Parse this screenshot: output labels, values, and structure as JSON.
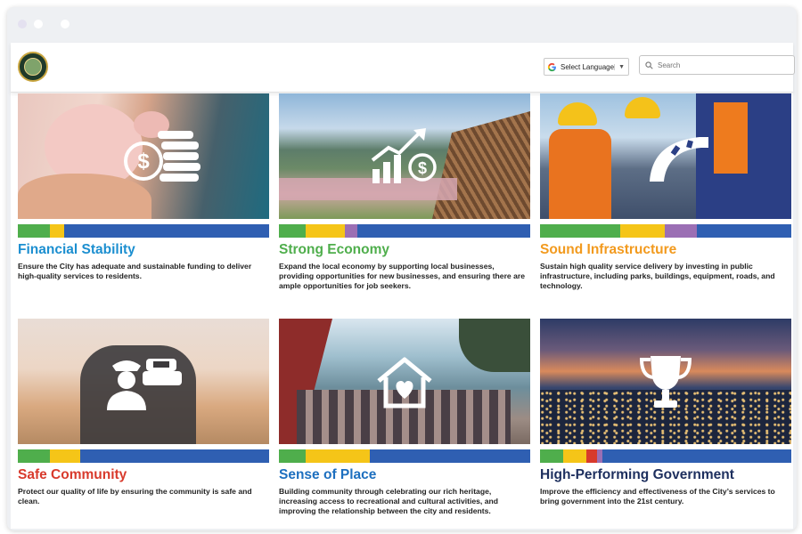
{
  "browser": {
    "window_dots": 3
  },
  "header": {
    "logo_alt": "City seal",
    "language_label": "Select Language",
    "language_caret": "▼",
    "search_placeholder": "Search"
  },
  "colors": {
    "green": "#4fae4c",
    "yellow": "#f5c518",
    "purple": "#9b6fb4",
    "blue": "#2f5fb2",
    "red": "#d83a2c"
  },
  "cards": [
    {
      "title": "Financial Stability",
      "title_color": "#1c8fd0",
      "icon": "dollar-coins-icon",
      "desc": "Ensure the City has adequate and sustainable funding to deliver high-quality services to residents."
    },
    {
      "title": "Strong Economy",
      "title_color": "#4fae4c",
      "icon": "growth-chart-dollar-icon",
      "desc": "Expand the local economy by supporting local businesses, providing opportunities for new businesses, and ensuring there are ample opportunities for job seekers."
    },
    {
      "title": "Sound Infrastructure",
      "title_color": "#f29a1e",
      "icon": "road-icon",
      "desc": "Sustain high quality service delivery by investing in public infrastructure, including parks, buildings, equipment, roads, and technology."
    },
    {
      "title": "Safe Community",
      "title_color": "#d83a2c",
      "icon": "police-officer-car-icon",
      "desc": "Protect our quality of life by ensuring the community is safe and clean."
    },
    {
      "title": "Sense of Place",
      "title_color": "#1d6fbf",
      "icon": "house-heart-icon",
      "desc": "Building community through celebrating our rich heritage, increasing access to recreational and cultural activities, and improving the relationship between the city and residents."
    },
    {
      "title": "High-Performing Government",
      "title_color": "#1d2f5e",
      "icon": "trophy-icon",
      "desc": "Improve the efficiency and effectiveness of the City’s services to bring government into the 21st century."
    }
  ]
}
